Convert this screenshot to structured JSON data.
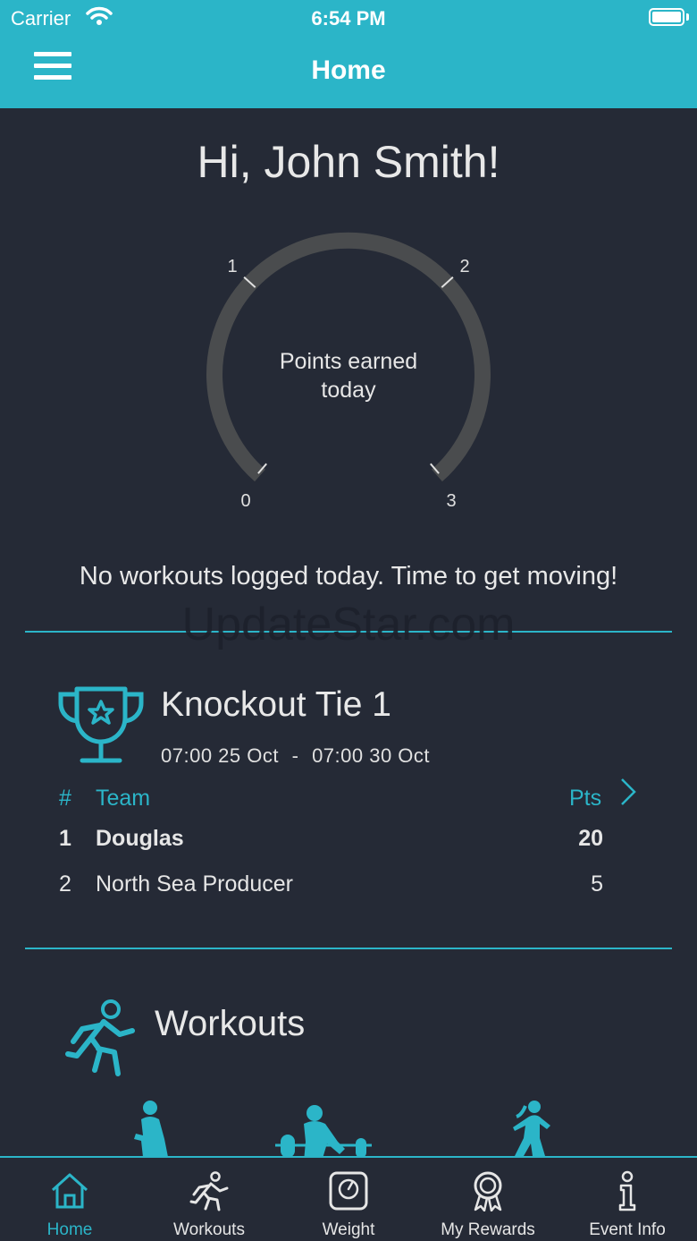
{
  "status_bar": {
    "carrier": "Carrier",
    "time": "6:54 PM"
  },
  "nav": {
    "title": "Home",
    "menu_icon": "hamburger-menu-icon"
  },
  "greeting": "Hi, John Smith!",
  "gauge": {
    "label": "Points earned today",
    "ticks": [
      "0",
      "1",
      "2",
      "3"
    ],
    "value": 0,
    "max": 3
  },
  "no_workouts_message": "No workouts logged today. Time to get moving!",
  "watermark": "UpdateStar.com",
  "competition": {
    "icon": "trophy-icon",
    "title": "Knockout Tie 1",
    "start": "07:00 25 Oct",
    "separator": "-",
    "end": "07:00 30 Oct",
    "headers": {
      "rank": "#",
      "team": "Team",
      "points": "Pts"
    },
    "rows": [
      {
        "rank": "1",
        "team": "Douglas",
        "points": "20"
      },
      {
        "rank": "2",
        "team": "North Sea Producer",
        "points": "5"
      }
    ]
  },
  "workouts": {
    "icon": "running-person-icon",
    "title": "Workouts"
  },
  "tabs": [
    {
      "label": "Home",
      "icon": "home-icon",
      "active": true
    },
    {
      "label": "Workouts",
      "icon": "running-icon",
      "active": false
    },
    {
      "label": "Weight",
      "icon": "scale-icon",
      "active": false
    },
    {
      "label": "My Rewards",
      "icon": "award-ribbon-icon",
      "active": false
    },
    {
      "label": "Event Info",
      "icon": "info-icon",
      "active": false
    }
  ],
  "colors": {
    "accent": "#2bb5c8",
    "background": "#252a36",
    "gauge_track": "#4a4c4e"
  }
}
